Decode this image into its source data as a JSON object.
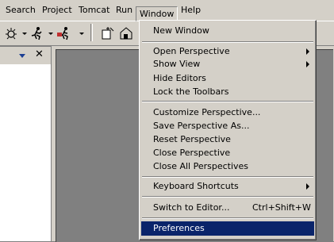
{
  "menubar": {
    "items": [
      "Search",
      "Project",
      "Tomcat",
      "Run",
      "Window",
      "Help"
    ]
  },
  "toolbar": {
    "icons": [
      "debug-icon",
      "run-icon",
      "external-tools-icon",
      "new-wizard-icon",
      "open-type-icon"
    ]
  },
  "window_menu": {
    "new_window": "New Window",
    "open_perspective": "Open Perspective",
    "show_view": "Show View",
    "hide_editors": "Hide Editors",
    "lock_toolbars": "Lock the Toolbars",
    "customize_perspective": "Customize Perspective...",
    "save_perspective_as": "Save Perspective As...",
    "reset_perspective": "Reset Perspective",
    "close_perspective": "Close Perspective",
    "close_all_perspectives": "Close All Perspectives",
    "keyboard_shortcuts": "Keyboard Shortcuts",
    "switch_to_editor": "Switch to Editor...",
    "switch_to_editor_shortcut": "Ctrl+Shift+W",
    "preferences": "Preferences"
  },
  "view": {
    "close_glyph": "✕"
  },
  "colors": {
    "face": "#d4d0c8",
    "selection": "#0a246a",
    "workspace": "#808080"
  }
}
